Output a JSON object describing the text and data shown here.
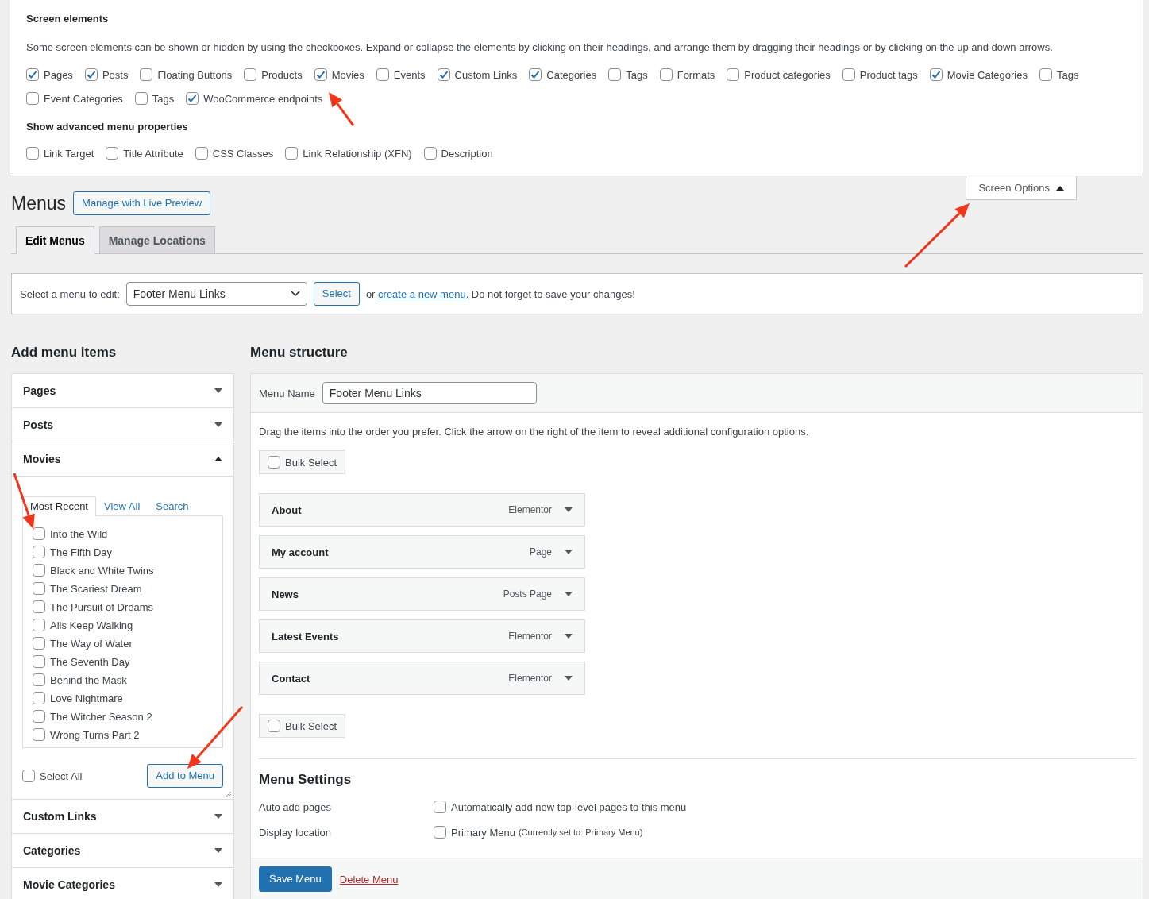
{
  "screen_options": {
    "title": "Screen elements",
    "description": "Some screen elements can be shown or hidden by using the checkboxes. Expand or collapse the elements by clicking on their headings, and arrange them by dragging their headings or by clicking on the up and down arrows.",
    "boxes": [
      {
        "label": "Pages",
        "checked": true
      },
      {
        "label": "Posts",
        "checked": true
      },
      {
        "label": "Floating Buttons",
        "checked": false
      },
      {
        "label": "Products",
        "checked": false
      },
      {
        "label": "Movies",
        "checked": true
      },
      {
        "label": "Events",
        "checked": false
      },
      {
        "label": "Custom Links",
        "checked": true
      },
      {
        "label": "Categories",
        "checked": true
      },
      {
        "label": "Tags",
        "checked": false
      },
      {
        "label": "Formats",
        "checked": false
      },
      {
        "label": "Product categories",
        "checked": false
      },
      {
        "label": "Product tags",
        "checked": false
      },
      {
        "label": "Movie Categories",
        "checked": true
      },
      {
        "label": "Tags",
        "checked": false
      },
      {
        "label": "Event Categories",
        "checked": false
      },
      {
        "label": "Tags",
        "checked": false
      },
      {
        "label": "WooCommerce endpoints",
        "checked": true
      }
    ],
    "advanced_title": "Show advanced menu properties",
    "advanced": [
      {
        "label": "Link Target",
        "checked": false
      },
      {
        "label": "Title Attribute",
        "checked": false
      },
      {
        "label": "CSS Classes",
        "checked": false
      },
      {
        "label": "Link Relationship (XFN)",
        "checked": false
      },
      {
        "label": "Description",
        "checked": false
      }
    ],
    "toggle": {
      "label": "Screen Options",
      "expanded": true
    }
  },
  "page": {
    "title": "Menus",
    "action": "Manage with Live Preview"
  },
  "tabs": [
    {
      "label": "Edit Menus",
      "selected": true
    },
    {
      "label": "Manage Locations",
      "selected": false
    }
  ],
  "menu_select": {
    "label": "Select a menu to edit:",
    "value": "Footer Menu Links",
    "button": "Select",
    "text_before": "or ",
    "link": "create a new menu",
    "text_after": ". Do not forget to save your changes!"
  },
  "add_items": {
    "title": "Add menu items",
    "sections": [
      {
        "title": "Pages",
        "expanded": false
      },
      {
        "title": "Posts",
        "expanded": false
      },
      {
        "title": "Movies",
        "expanded": true,
        "tabs": [
          {
            "label": "Most Recent",
            "selected": true
          },
          {
            "label": "View All",
            "selected": false
          },
          {
            "label": "Search",
            "selected": false
          }
        ],
        "items": [
          {
            "label": "Into the Wild",
            "checked": false
          },
          {
            "label": "The Fifth Day",
            "checked": false
          },
          {
            "label": "Black and White Twins",
            "checked": false
          },
          {
            "label": "The Scariest Dream",
            "checked": false
          },
          {
            "label": "The Pursuit of Dreams",
            "checked": false
          },
          {
            "label": "Alis Keep Walking",
            "checked": false
          },
          {
            "label": "The Way of Water",
            "checked": false
          },
          {
            "label": "The Seventh Day",
            "checked": false
          },
          {
            "label": "Behind the Mask",
            "checked": false
          },
          {
            "label": "Love Nightmare",
            "checked": false
          },
          {
            "label": "The Witcher Season 2",
            "checked": false
          },
          {
            "label": "Wrong Turns Part 2",
            "checked": false
          }
        ],
        "select_all": {
          "label": "Select All",
          "checked": false
        },
        "button": "Add to Menu"
      },
      {
        "title": "Custom Links",
        "expanded": false
      },
      {
        "title": "Categories",
        "expanded": false
      },
      {
        "title": "Movie Categories",
        "expanded": false
      }
    ]
  },
  "structure": {
    "title": "Menu structure",
    "name_label": "Menu Name",
    "name_value": "Footer Menu Links",
    "instructions": "Drag the items into the order you prefer. Click the arrow on the right of the item to reveal additional configuration options.",
    "bulk_select": {
      "label": "Bulk Select",
      "checked": false
    },
    "items": [
      {
        "title": "About",
        "type": "Elementor"
      },
      {
        "title": "My account",
        "type": "Page"
      },
      {
        "title": "News",
        "type": "Posts Page"
      },
      {
        "title": "Latest Events",
        "type": "Elementor"
      },
      {
        "title": "Contact",
        "type": "Elementor"
      }
    ],
    "bulk_select_bottom": {
      "label": "Bulk Select",
      "checked": false
    },
    "settings": {
      "title": "Menu Settings",
      "rows": [
        {
          "label": "Auto add pages",
          "option": "Automatically add new top-level pages to this menu",
          "checked": false
        },
        {
          "label": "Display location",
          "option": "Primary Menu",
          "note": "(Currently set to: Primary Menu)",
          "checked": false
        }
      ]
    },
    "save": "Save Menu",
    "delete": "Delete Menu"
  }
}
